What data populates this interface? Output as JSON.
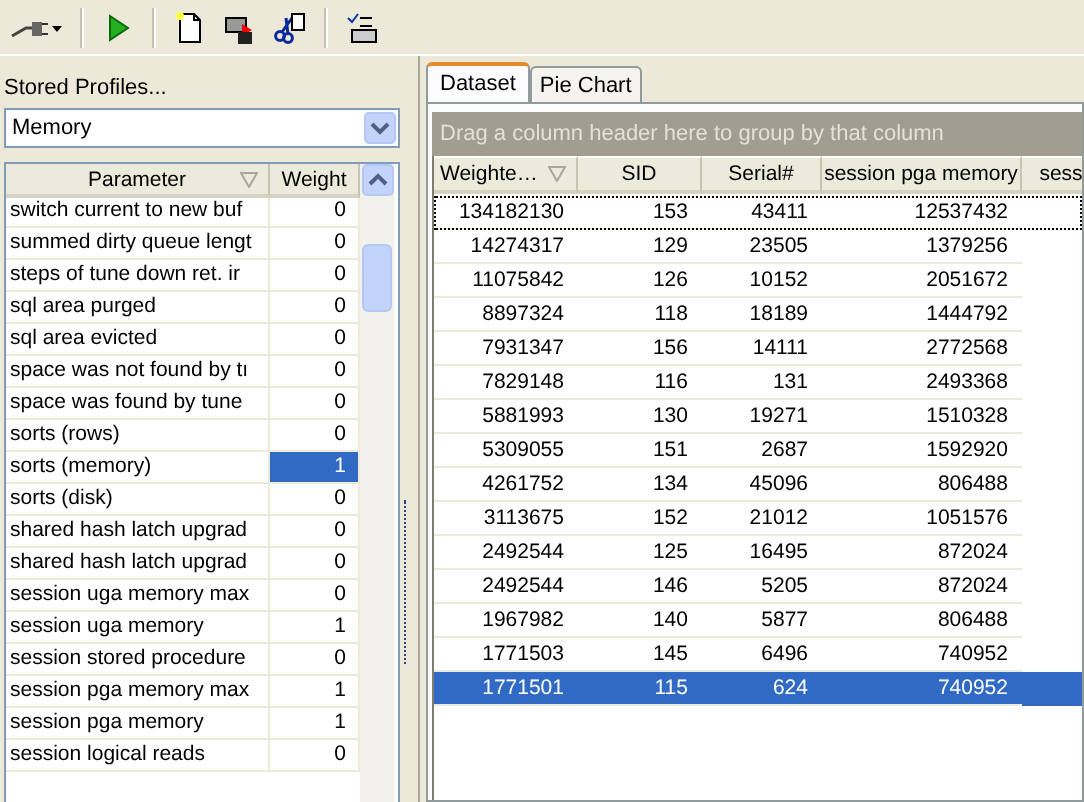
{
  "toolbar": {
    "buttons": [
      {
        "kind": "plug"
      },
      {
        "kind": "play"
      },
      {
        "kind": "new"
      },
      {
        "kind": "save"
      },
      {
        "kind": "cut"
      },
      {
        "kind": "checklist"
      }
    ]
  },
  "profiles": {
    "label": "Stored Profiles...",
    "value": "Memory"
  },
  "parameters": {
    "columns": [
      "Parameter",
      "Weight"
    ],
    "rows": [
      {
        "name": "switch current to new buf",
        "weight": "0",
        "selected": false
      },
      {
        "name": "summed dirty queue lengt",
        "weight": "0",
        "selected": false
      },
      {
        "name": "steps of tune down ret. ir",
        "weight": "0",
        "selected": false
      },
      {
        "name": "sql area purged",
        "weight": "0",
        "selected": false
      },
      {
        "name": "sql area evicted",
        "weight": "0",
        "selected": false
      },
      {
        "name": "space was not found by tı",
        "weight": "0",
        "selected": false
      },
      {
        "name": "space was found by tune",
        "weight": "0",
        "selected": false
      },
      {
        "name": "sorts (rows)",
        "weight": "0",
        "selected": false
      },
      {
        "name": "sorts (memory)",
        "weight": "1",
        "selected": true
      },
      {
        "name": "sorts (disk)",
        "weight": "0",
        "selected": false
      },
      {
        "name": "shared hash latch upgrad",
        "weight": "0",
        "selected": false
      },
      {
        "name": "shared hash latch upgrad",
        "weight": "0",
        "selected": false
      },
      {
        "name": "session uga memory max",
        "weight": "0",
        "selected": false
      },
      {
        "name": "session uga memory",
        "weight": "1",
        "selected": false
      },
      {
        "name": "session stored procedure",
        "weight": "0",
        "selected": false
      },
      {
        "name": "session pga memory max",
        "weight": "1",
        "selected": false
      },
      {
        "name": "session pga memory",
        "weight": "1",
        "selected": false
      },
      {
        "name": "session logical reads",
        "weight": "0",
        "selected": false
      }
    ]
  },
  "tabs": [
    {
      "label": "Dataset",
      "selected": true
    },
    {
      "label": "Pie Chart",
      "selected": false
    }
  ],
  "group_hint": "Drag a column header here to group by that column",
  "dataset": {
    "columns": [
      "Weighte…",
      "SID",
      "Serial#",
      "session pga memory",
      "sess"
    ],
    "rows": [
      {
        "cells": [
          "134182130",
          "153",
          "43411",
          "12537432"
        ],
        "selected": false,
        "focused": true
      },
      {
        "cells": [
          "14274317",
          "129",
          "23505",
          "1379256"
        ],
        "selected": false,
        "focused": false
      },
      {
        "cells": [
          "11075842",
          "126",
          "10152",
          "2051672"
        ],
        "selected": false,
        "focused": false
      },
      {
        "cells": [
          "8897324",
          "118",
          "18189",
          "1444792"
        ],
        "selected": false,
        "focused": false
      },
      {
        "cells": [
          "7931347",
          "156",
          "14111",
          "2772568"
        ],
        "selected": false,
        "focused": false
      },
      {
        "cells": [
          "7829148",
          "116",
          "131",
          "2493368"
        ],
        "selected": false,
        "focused": false
      },
      {
        "cells": [
          "5881993",
          "130",
          "19271",
          "1510328"
        ],
        "selected": false,
        "focused": false
      },
      {
        "cells": [
          "5309055",
          "151",
          "2687",
          "1592920"
        ],
        "selected": false,
        "focused": false
      },
      {
        "cells": [
          "4261752",
          "134",
          "45096",
          "806488"
        ],
        "selected": false,
        "focused": false
      },
      {
        "cells": [
          "3113675",
          "152",
          "21012",
          "1051576"
        ],
        "selected": false,
        "focused": false
      },
      {
        "cells": [
          "2492544",
          "125",
          "16495",
          "872024"
        ],
        "selected": false,
        "focused": false
      },
      {
        "cells": [
          "2492544",
          "146",
          "5205",
          "872024"
        ],
        "selected": false,
        "focused": false
      },
      {
        "cells": [
          "1967982",
          "140",
          "5877",
          "806488"
        ],
        "selected": false,
        "focused": false
      },
      {
        "cells": [
          "1771503",
          "145",
          "6496",
          "740952"
        ],
        "selected": false,
        "focused": false
      },
      {
        "cells": [
          "1771501",
          "115",
          "624",
          "740952"
        ],
        "selected": true,
        "focused": false
      }
    ]
  }
}
